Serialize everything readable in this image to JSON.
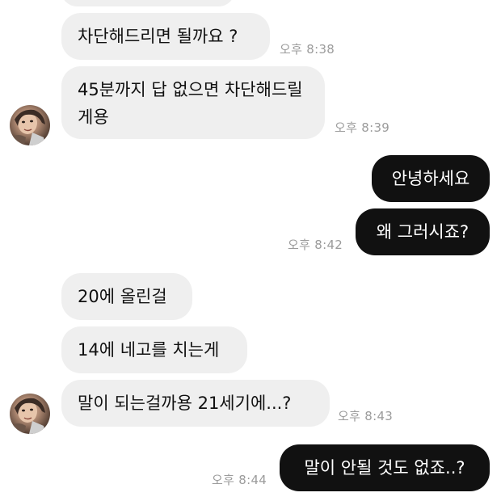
{
  "messages": [
    {
      "text": "",
      "direction": "incoming"
    },
    {
      "text": "차단해드리면 될까요 ?",
      "direction": "incoming",
      "time": "오후 8:38"
    },
    {
      "text": "45분까지 답 없으면 차단해드릴게용",
      "direction": "incoming",
      "time": "오후 8:39"
    },
    {
      "text": "안녕하세요",
      "direction": "outgoing"
    },
    {
      "text": "왜 그러시죠?",
      "direction": "outgoing",
      "time": "오후 8:42"
    },
    {
      "text": "20에 올린걸",
      "direction": "incoming"
    },
    {
      "text": "14에 네고를 치는게",
      "direction": "incoming"
    },
    {
      "text": "말이 되는걸까용 21세기에...?",
      "direction": "incoming",
      "time": "오후 8:43"
    },
    {
      "text": "말이 안될 것도 없죠..?",
      "direction": "outgoing",
      "time": "오후 8:44"
    }
  ],
  "colors": {
    "incoming_bubble": "#efefef",
    "outgoing_bubble": "#111111",
    "timestamp": "#9b9b9b"
  },
  "icons": {
    "avatar": "user-avatar"
  }
}
